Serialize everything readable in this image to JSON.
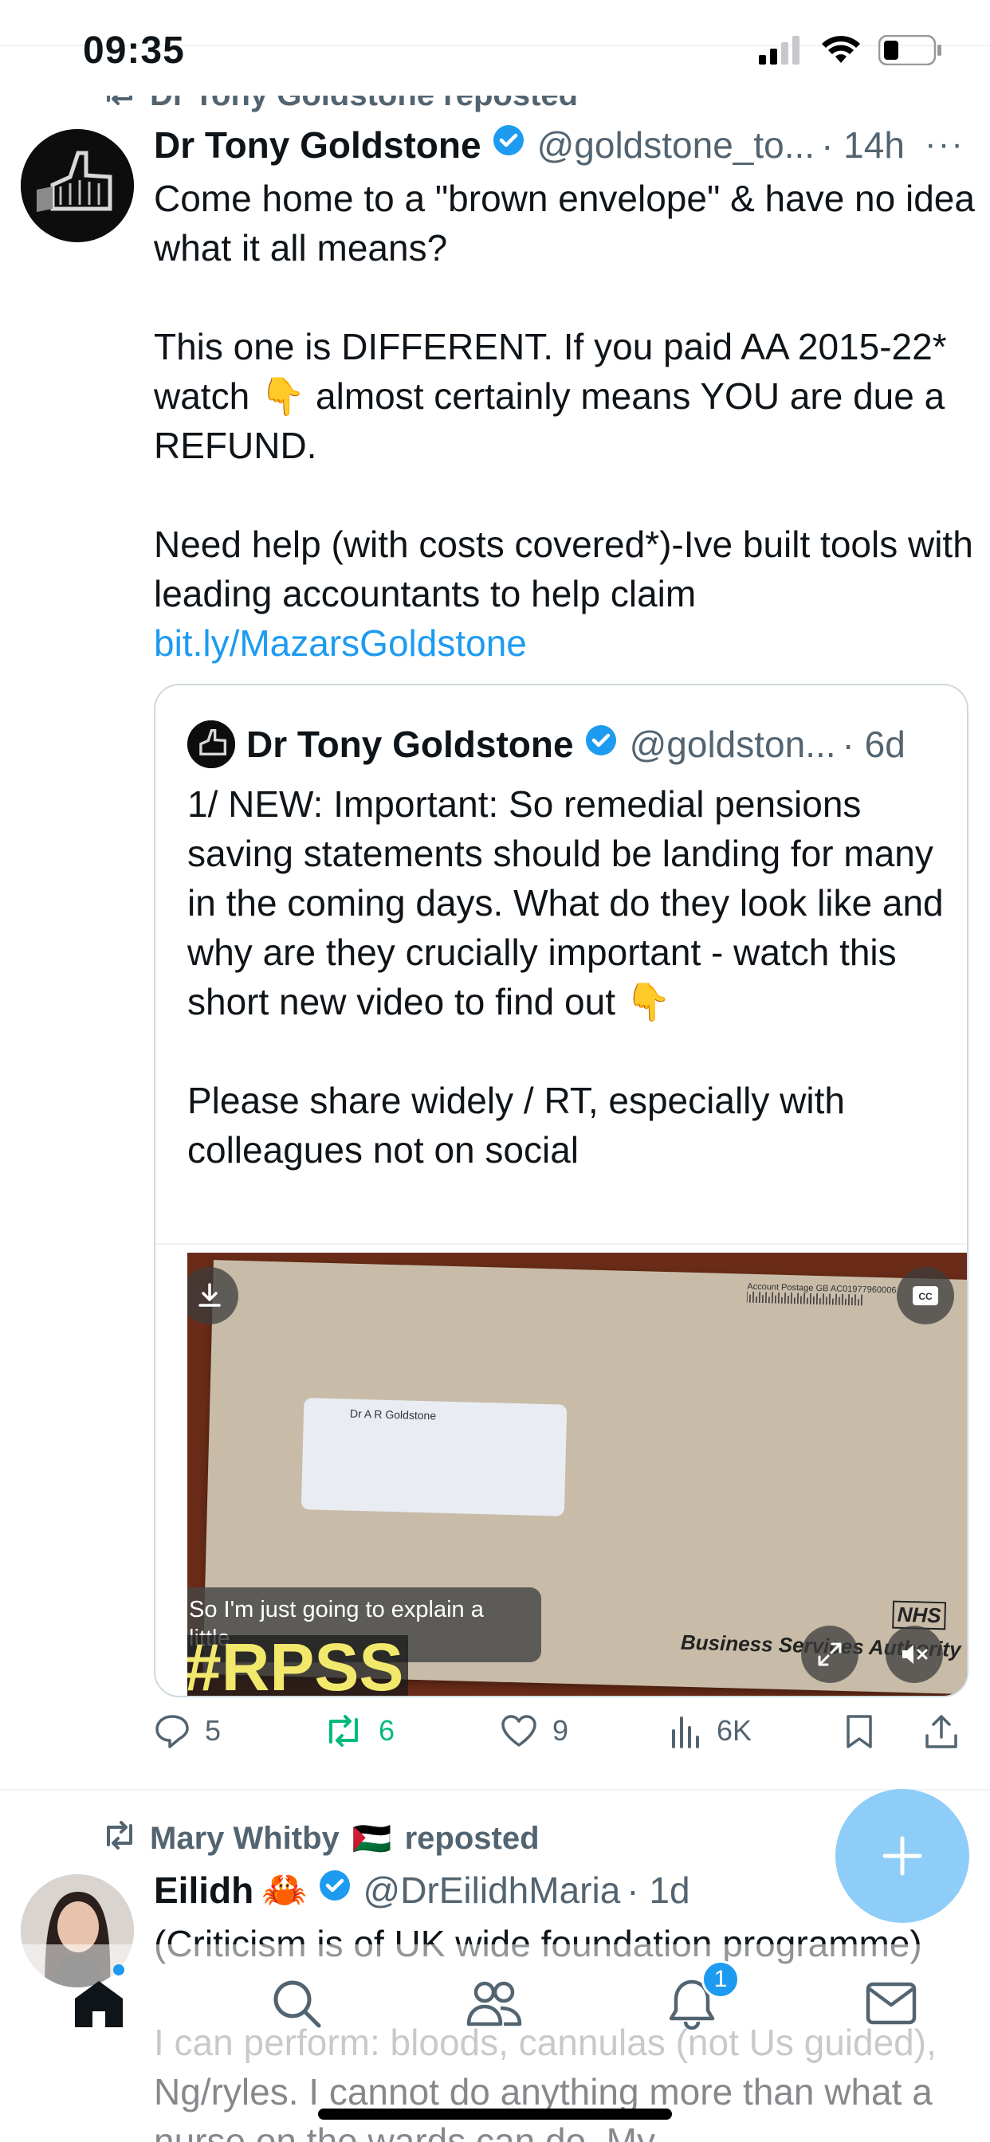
{
  "status_bar": {
    "time": "09:35"
  },
  "tweet1": {
    "reposted_by": "Dr Tony Goldstone reposted",
    "author_name": "Dr Tony Goldstone",
    "handle": "@goldstone_to...",
    "time": "· 14h",
    "text_p1": "Come home to a \"brown envelope\" & have no idea what it all means?",
    "text_p2_a": "This one is DIFFERENT. If you paid AA 2015-22* watch ",
    "emoji_point": "👇",
    "text_p2_b": " almost certainly means YOU are due a REFUND.",
    "text_p3": "Need help (with costs covered*)-Ive built tools with leading accountants to help claim ",
    "link": "bit.ly/MazarsGoldstone",
    "quote": {
      "author_name": "Dr Tony Goldstone",
      "handle": "@goldston...",
      "time": "· 6d",
      "text_p1": "1/ NEW: Important: So remedial pensions saving statements should be landing for many in the coming days. What do they look like and why are they crucially important - watch this short new video to find out ",
      "text_p2": "Please share widely / RT, especially with colleagues not on social",
      "media": {
        "envelope_name": "Dr A R Goldstone",
        "postage_text": "Account Postage GB AC01977960006",
        "nhs_logo": "NHS",
        "authority": "Business Services Authority",
        "caption": "So I'm just going to explain a little",
        "hashtag": "#RPSS"
      }
    },
    "actions": {
      "replies": "5",
      "reposts": "6",
      "likes": "9",
      "views": "6K"
    }
  },
  "tweet2": {
    "reposted_by_name": "Mary Whitby",
    "flag": "🇵🇸",
    "reposted_suffix": "reposted",
    "author_name": "Eilidh",
    "author_emoji": "🦀",
    "handle": "@DrEilidhMaria",
    "time": "· 1d",
    "text_line1": "(Criticism is of UK wide foundation programme)",
    "text_p2": "I can perform: bloods, cannulas (not Us guided), Ng/ryles. I cannot do anything more than what a nurse on the wards can do. My"
  },
  "bottom_nav": {
    "notifications_badge": "1"
  },
  "colors": {
    "accent": "#1d9bf0",
    "repost_green": "#00ba7c",
    "muted": "#536471",
    "fab": "#8ecdf8"
  }
}
